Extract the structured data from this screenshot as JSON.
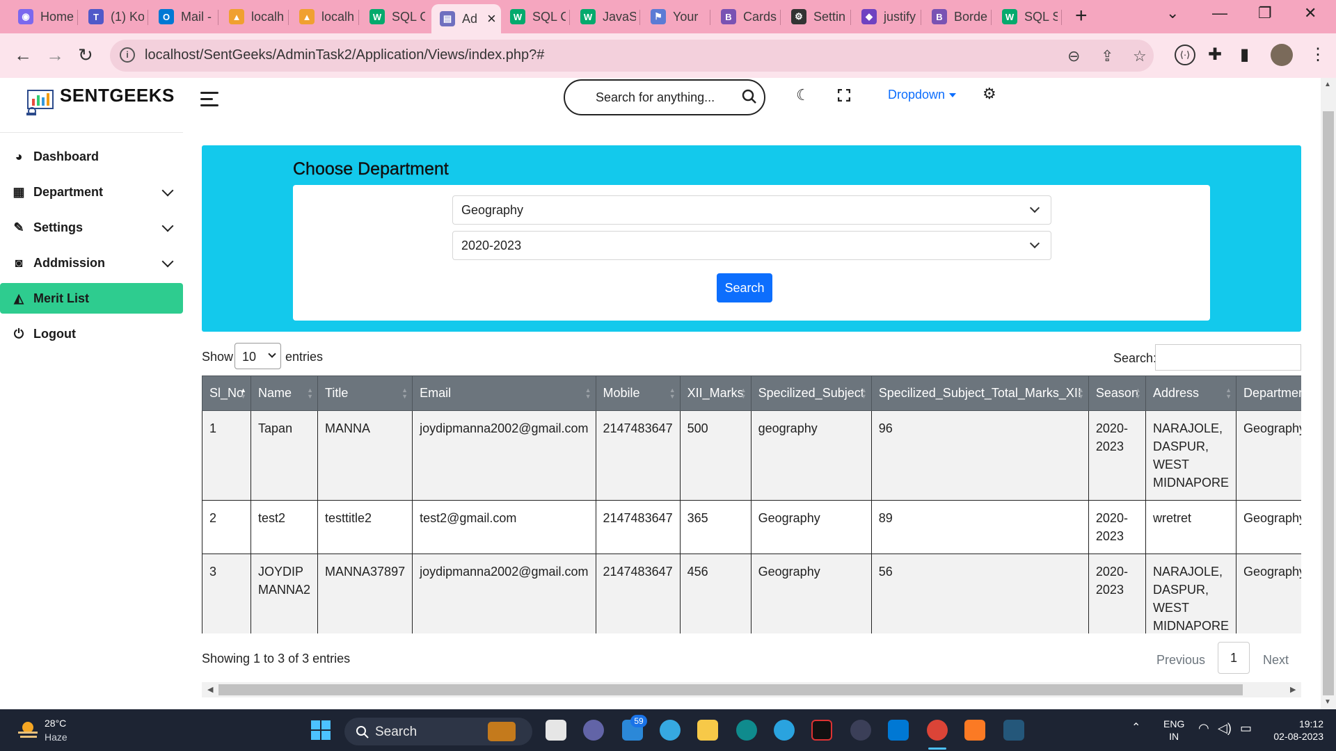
{
  "browser": {
    "tabs": [
      {
        "label": "Home",
        "color": "#7b68ee",
        "glyph": "◉"
      },
      {
        "label": "(1) Ko",
        "color": "#5059c9",
        "glyph": "T"
      },
      {
        "label": "Mail -",
        "color": "#0078d4",
        "glyph": "O"
      },
      {
        "label": "localh",
        "color": "#f0a030",
        "glyph": "▲"
      },
      {
        "label": "localh",
        "color": "#f0a030",
        "glyph": "▲"
      },
      {
        "label": "SQL C",
        "color": "#04aa6d",
        "glyph": "W"
      },
      {
        "label": "Ad",
        "color": "#6f6fbf",
        "glyph": "▤",
        "active": true
      },
      {
        "label": "SQL C",
        "color": "#04aa6d",
        "glyph": "W"
      },
      {
        "label": "JavaS",
        "color": "#04aa6d",
        "glyph": "W"
      },
      {
        "label": "Your",
        "color": "#5b7bd5",
        "glyph": "⚑"
      },
      {
        "label": "Cards",
        "color": "#7952b3",
        "glyph": "B"
      },
      {
        "label": "Settin",
        "color": "#333333",
        "glyph": "⚙"
      },
      {
        "label": "justify",
        "color": "#6f42c1",
        "glyph": "◆"
      },
      {
        "label": "Borde",
        "color": "#7952b3",
        "glyph": "B"
      },
      {
        "label": "SQL S",
        "color": "#04aa6d",
        "glyph": "W"
      }
    ],
    "url": "localhost/SentGeeks/AdminTask2/Application/Views/index.php?#"
  },
  "app": {
    "brand": "SENTGEEKS",
    "search_placeholder": "Search for anything...",
    "dropdown_label": "Dropdown"
  },
  "sidebar": {
    "items": [
      {
        "label": "Dashboard",
        "icon": "palette-icon",
        "glyph": "◕",
        "expandable": false
      },
      {
        "label": "Department",
        "icon": "building-icon",
        "glyph": "▦",
        "expandable": true
      },
      {
        "label": "Settings",
        "icon": "wrench-icon",
        "glyph": "✎",
        "expandable": true
      },
      {
        "label": "Addmission",
        "icon": "binoculars-icon",
        "glyph": "◙",
        "expandable": true
      },
      {
        "label": "Merit List",
        "icon": "graduation-cap-icon",
        "glyph": "◭",
        "expandable": false,
        "active": true
      },
      {
        "label": "Logout",
        "icon": "power-icon",
        "glyph": "⏻",
        "expandable": false
      }
    ]
  },
  "filter": {
    "heading": "Choose Department",
    "department_value": "Geography",
    "season_value": "2020-2023",
    "search_label": "Search"
  },
  "datatable": {
    "show_label": "Show",
    "length_value": "10",
    "entries_label": "entries",
    "search_label": "Search:",
    "columns": [
      "Sl_No",
      "Name",
      "Title",
      "Email",
      "Mobile",
      "XII_Marks",
      "Specilized_Subject",
      "Specilized_Subject_Total_Marks_XII",
      "Season",
      "Address",
      "Department"
    ],
    "rows": [
      [
        "1",
        "Tapan",
        "MANNA",
        "joydipmanna2002@gmail.com",
        "2147483647",
        "500",
        "geography",
        "96",
        "2020-2023",
        "NARAJOLE, DASPUR, WEST MIDNAPORE",
        "Geography"
      ],
      [
        "2",
        "test2",
        "testtitle2",
        "test2@gmail.com",
        "2147483647",
        "365",
        "Geography",
        "89",
        "2020-2023",
        "wretret",
        "Geography"
      ],
      [
        "3",
        "JOYDIP MANNA2",
        "MANNA37897",
        "joydipmanna2002@gmail.com",
        "2147483647",
        "456",
        "Geography",
        "56",
        "2020-2023",
        "NARAJOLE, DASPUR, WEST MIDNAPORE",
        "Geography"
      ]
    ],
    "info": "Showing 1 to 3 of 3 entries",
    "prev_label": "Previous",
    "page": "1",
    "next_label": "Next"
  },
  "taskbar": {
    "temperature": "28°C",
    "condition": "Haze",
    "search_label": "Search",
    "mail_badge": "59",
    "lang_1": "ENG",
    "lang_2": "IN",
    "time": "19:12",
    "date": "02-08-2023"
  }
}
